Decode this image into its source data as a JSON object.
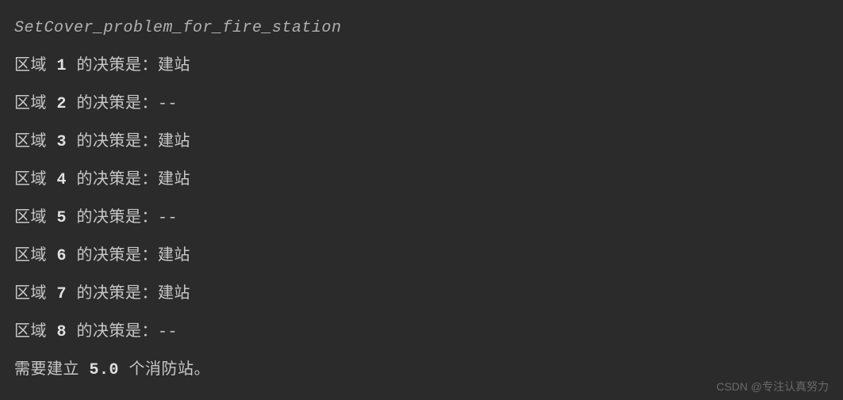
{
  "title": "SetCover_problem_for_fire_station",
  "line_prefix": "区域 ",
  "line_middle": " 的决策是：",
  "regions": [
    {
      "num": "1",
      "decision": "建站"
    },
    {
      "num": "2",
      "decision": "--"
    },
    {
      "num": "3",
      "decision": "建站"
    },
    {
      "num": "4",
      "decision": "建站"
    },
    {
      "num": "5",
      "decision": "--"
    },
    {
      "num": "6",
      "decision": "建站"
    },
    {
      "num": "7",
      "decision": "建站"
    },
    {
      "num": "8",
      "decision": "--"
    }
  ],
  "summary_prefix": "需要建立 ",
  "summary_value": "5.0",
  "summary_suffix": " 个消防站。",
  "watermark": "CSDN @专注认真努力"
}
